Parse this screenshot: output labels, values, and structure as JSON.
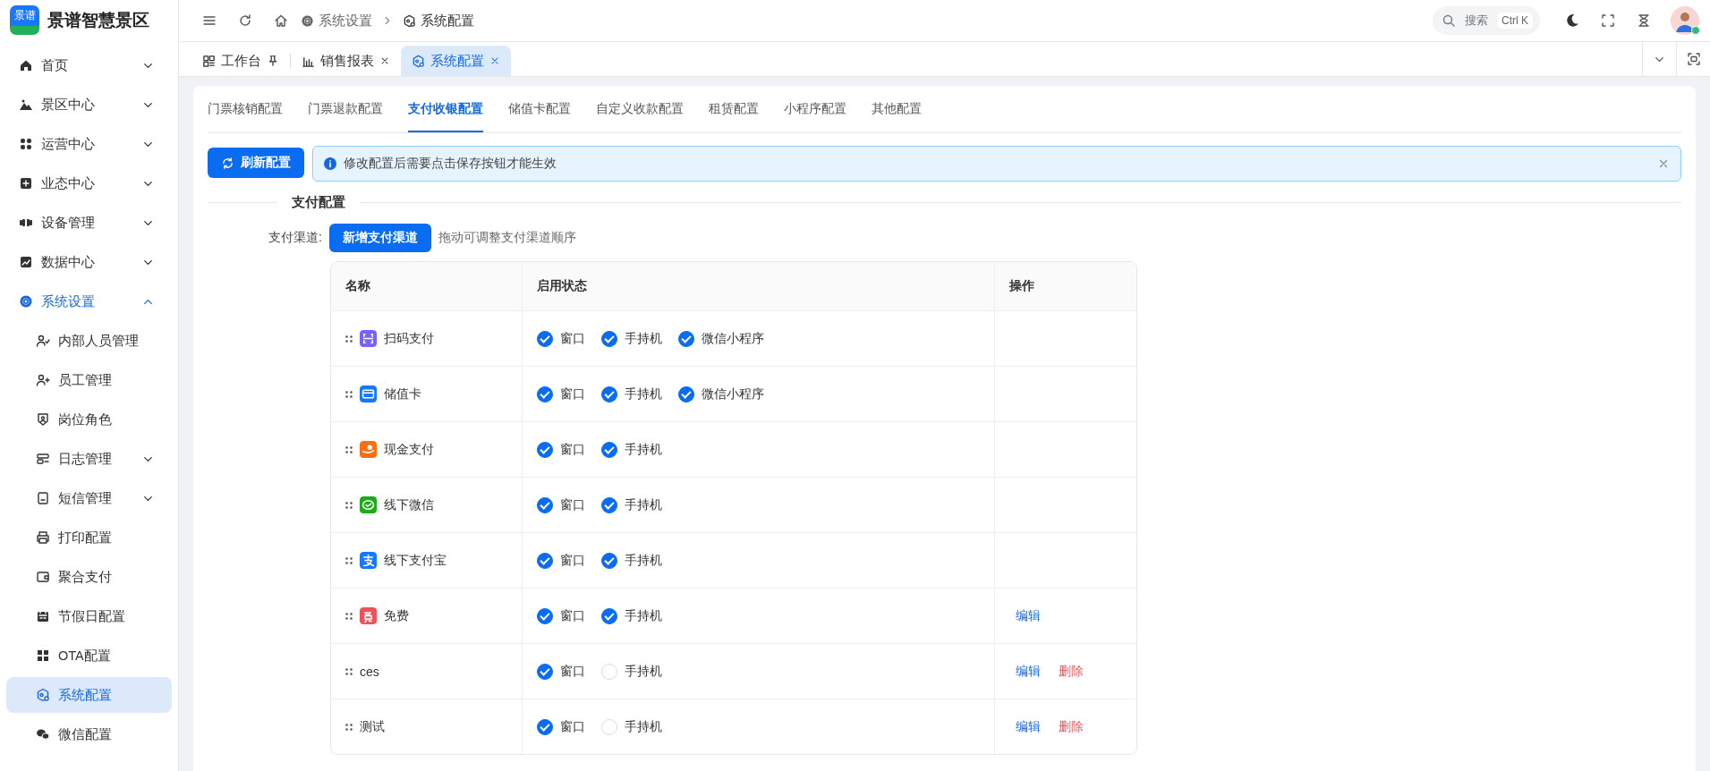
{
  "brand": {
    "logo_text": "景谱",
    "name": "景谱智慧景区"
  },
  "sidebar": {
    "items": [
      {
        "label": "首页",
        "expanded": false,
        "selected": false
      },
      {
        "label": "景区中心",
        "expanded": false,
        "selected": false
      },
      {
        "label": "运营中心",
        "expanded": false,
        "selected": false
      },
      {
        "label": "业态中心",
        "expanded": false,
        "selected": false
      },
      {
        "label": "设备管理",
        "expanded": false,
        "selected": false
      },
      {
        "label": "数据中心",
        "expanded": false,
        "selected": false
      },
      {
        "label": "系统设置",
        "expanded": true,
        "selected": false,
        "children": [
          {
            "label": "内部人员管理",
            "selected": false
          },
          {
            "label": "员工管理",
            "selected": false
          },
          {
            "label": "岗位角色",
            "selected": false
          },
          {
            "label": "日志管理",
            "expanded": false,
            "selected": false
          },
          {
            "label": "短信管理",
            "expanded": false,
            "selected": false
          },
          {
            "label": "打印配置",
            "selected": false
          },
          {
            "label": "聚合支付",
            "selected": false
          },
          {
            "label": "节假日配置",
            "selected": false
          },
          {
            "label": "OTA配置",
            "selected": false
          },
          {
            "label": "系统配置",
            "selected": true
          },
          {
            "label": "微信配置",
            "selected": false
          }
        ]
      }
    ]
  },
  "breadcrumb": [
    "系统设置",
    "系统配置"
  ],
  "search": {
    "placeholder": "搜索",
    "shortcut": "Ctrl K"
  },
  "page_tabs": [
    {
      "label": "工作台",
      "kind": "pinned",
      "selected": false
    },
    {
      "label": "销售报表",
      "kind": "closable",
      "selected": false
    },
    {
      "label": "系统配置",
      "kind": "closable",
      "selected": true
    }
  ],
  "config_tabs": [
    {
      "label": "门票核销配置",
      "selected": false
    },
    {
      "label": "门票退款配置",
      "selected": false
    },
    {
      "label": "支付收银配置",
      "selected": true
    },
    {
      "label": "储值卡配置",
      "selected": false
    },
    {
      "label": "自定义收款配置",
      "selected": false
    },
    {
      "label": "租赁配置",
      "selected": false
    },
    {
      "label": "小程序配置",
      "selected": false
    },
    {
      "label": "其他配置",
      "selected": false
    }
  ],
  "refresh_button": "刷新配置",
  "alert": {
    "text": "修改配置后需要点击保存按钮才能生效"
  },
  "section_title": "支付配置",
  "channel_label": "支付渠道:",
  "add_button": "新增支付渠道",
  "drag_hint": "拖动可调整支付渠道顺序",
  "table": {
    "columns": [
      "名称",
      "启用状态",
      "操作"
    ],
    "rows": [
      {
        "name": "扫码支付",
        "color": "#7b61ff",
        "options": [
          {
            "label": "窗口",
            "checked": true
          },
          {
            "label": "手持机",
            "checked": true
          },
          {
            "label": "微信小程序",
            "checked": true
          }
        ]
      },
      {
        "name": "储值卡",
        "color": "#1677ff",
        "options": [
          {
            "label": "窗口",
            "checked": true
          },
          {
            "label": "手持机",
            "checked": true
          },
          {
            "label": "微信小程序",
            "checked": true
          }
        ]
      },
      {
        "name": "现金支付",
        "color": "#fa6e14",
        "options": [
          {
            "label": "窗口",
            "checked": true
          },
          {
            "label": "手持机",
            "checked": true
          }
        ]
      },
      {
        "name": "线下微信",
        "color": "#1aad19",
        "options": [
          {
            "label": "窗口",
            "checked": true
          },
          {
            "label": "手持机",
            "checked": true
          }
        ]
      },
      {
        "name": "线下支付宝",
        "color": "#1677ff",
        "options": [
          {
            "label": "窗口",
            "checked": true
          },
          {
            "label": "手持机",
            "checked": true
          }
        ]
      },
      {
        "name": "免费",
        "color": "#f0505a",
        "options": [
          {
            "label": "窗口",
            "checked": true
          },
          {
            "label": "手持机",
            "checked": true
          }
        ],
        "actions": [
          {
            "label": "编辑",
            "kind": "edit"
          }
        ]
      },
      {
        "name": "ces",
        "options": [
          {
            "label": "窗口",
            "checked": true
          },
          {
            "label": "手持机",
            "checked": false
          }
        ],
        "actions": [
          {
            "label": "编辑",
            "kind": "edit"
          },
          {
            "label": "删除",
            "kind": "delete"
          }
        ]
      },
      {
        "name": "测试",
        "options": [
          {
            "label": "窗口",
            "checked": true
          },
          {
            "label": "手持机",
            "checked": false
          }
        ],
        "actions": [
          {
            "label": "编辑",
            "kind": "edit"
          },
          {
            "label": "删除",
            "kind": "delete"
          }
        ]
      }
    ]
  }
}
